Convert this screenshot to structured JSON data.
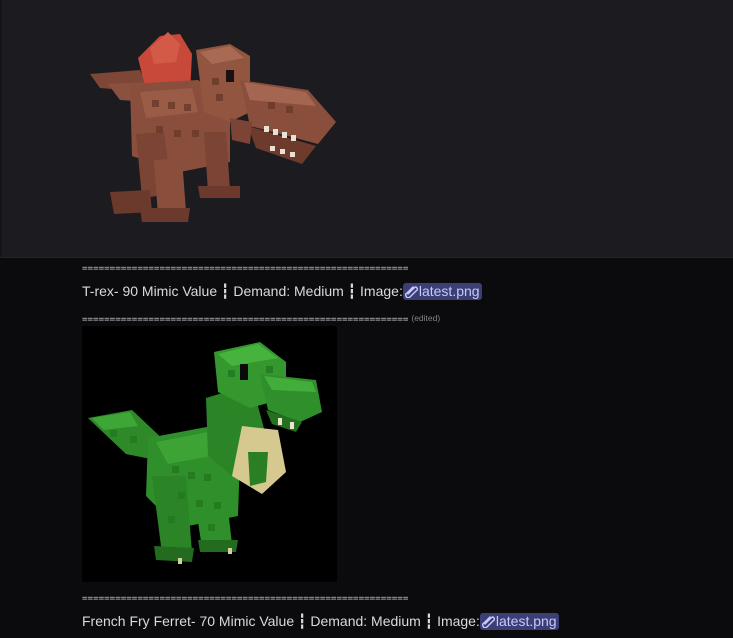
{
  "messages": [
    {
      "separator_top": "===========================================================",
      "text_parts": {
        "name": "T-rex- 90 Mimic Value",
        "bar1": "┇",
        "demand": "Demand: Medium",
        "bar2": "┇",
        "image_label": "Image:",
        "attachment": "latest.png"
      },
      "separator_bottom": "===========================================================",
      "edited": "(edited)"
    },
    {
      "separator_top": "===========================================================",
      "text_parts": {
        "name": "French Fry Ferret- 70 Mimic Value",
        "bar1": "┇",
        "demand": "Demand: Medium",
        "bar2": "┇",
        "image_label": "Image:",
        "attachment": "latest.png"
      }
    }
  ],
  "colors": {
    "background": "#0b0b0e",
    "embed_panel": "#1c1c20",
    "attachment_bg": "#3b3f74",
    "attachment_text": "#c4c9ff",
    "trex_body": "#8a4f3c",
    "trex_spikes": "#c8483a",
    "raptor_body": "#2f8f2a"
  },
  "icons": {
    "attachment": "paperclip-icon"
  }
}
